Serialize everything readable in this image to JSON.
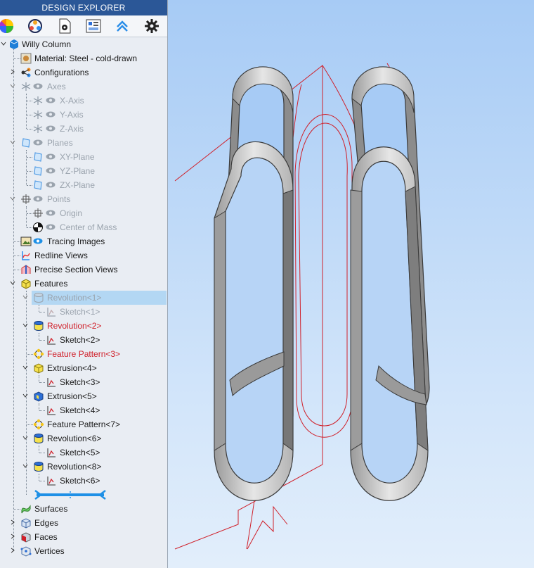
{
  "panel": {
    "title": "DESIGN EXPLORER"
  },
  "toolbar": {
    "icons": [
      "color-wheel-icon",
      "parts-icon",
      "document-gear-icon",
      "layout-icon",
      "collapse-up-icon",
      "gear-icon"
    ]
  },
  "tree": {
    "root": "Willy Column",
    "material": "Material: Steel - cold-drawn",
    "configurations": "Configurations",
    "axes": "Axes",
    "x_axis": "X-Axis",
    "y_axis": "Y-Axis",
    "z_axis": "Z-Axis",
    "planes": "Planes",
    "xy_plane": "XY-Plane",
    "yz_plane": "YZ-Plane",
    "zx_plane": "ZX-Plane",
    "points": "Points",
    "origin": "Origin",
    "center_of_mass": "Center of Mass",
    "tracing_images": "Tracing Images",
    "redline_views": "Redline Views",
    "precise_section_views": "Precise Section Views",
    "features": "Features",
    "revolution1": "Revolution<1>",
    "sketch1": "Sketch<1>",
    "revolution2": "Revolution<2>",
    "sketch2": "Sketch<2>",
    "feature_pattern3": "Feature Pattern<3>",
    "extrusion4": "Extrusion<4>",
    "sketch3": "Sketch<3>",
    "extrusion5": "Extrusion<5>",
    "sketch4": "Sketch<4>",
    "feature_pattern7": "Feature Pattern<7>",
    "revolution6": "Revolution<6>",
    "sketch5": "Sketch<5>",
    "revolution8": "Revolution<8>",
    "sketch6": "Sketch<6>",
    "surfaces": "Surfaces",
    "edges": "Edges",
    "faces": "Faces",
    "vertices": "Vertices"
  },
  "colors": {
    "title_bar": "#2b5797",
    "selection": "#b3d7f3",
    "sketch_red": "#d0202a",
    "rollback_bar": "#1e90e6"
  }
}
